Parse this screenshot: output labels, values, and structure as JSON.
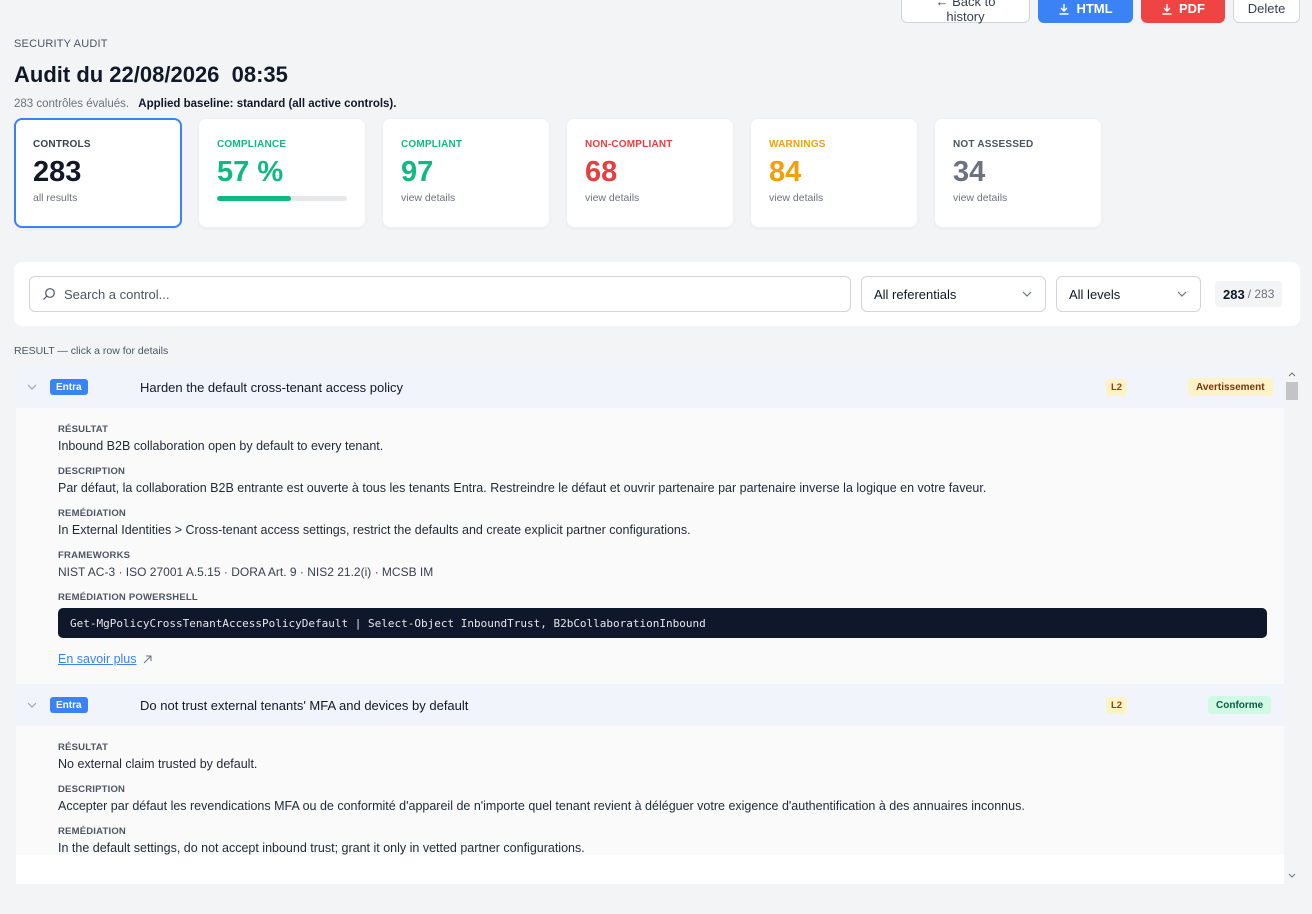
{
  "toolbar": {
    "back_label": "← Back to history",
    "html_label": "HTML",
    "pdf_label": "PDF",
    "delete_label": "Delete"
  },
  "header": {
    "eyebrow": "SECURITY AUDIT",
    "title": "Audit du 22/08/2026  08:35",
    "controls_evaluated": "283 contrôles évalués.",
    "baseline": "Applied baseline: standard (all active controls)."
  },
  "cards": {
    "controls": {
      "label": "CONTROLS",
      "value": "283",
      "sub": "all results"
    },
    "compliance": {
      "label": "COMPLIANCE",
      "value": "57 %",
      "progress": 0.57
    },
    "compliant": {
      "label": "COMPLIANT",
      "value": "97",
      "sub": "view details"
    },
    "non_compliant": {
      "label": "NON-COMPLIANT",
      "value": "68",
      "sub": "view details"
    },
    "warnings": {
      "label": "WARNINGS",
      "value": "84",
      "sub": "view details"
    },
    "not_assessed": {
      "label": "NOT ASSESSED",
      "value": "34",
      "sub": "view details"
    }
  },
  "colors": {
    "accent": "#3b82f6",
    "compliance": "#10b981",
    "compliant": "#10b981",
    "non_compliant": "#e53e3e",
    "warnings": "#f59e0b",
    "not_assessed": "#6b7280"
  },
  "filters": {
    "search_placeholder": "Search a control...",
    "referential": "All referentials",
    "level": "All levels",
    "count_shown": "283",
    "count_total": "/ 283"
  },
  "result_label": "RESULT — click a row for details",
  "rows": [
    {
      "tag": "Entra",
      "title": "Harden the default cross-tenant access policy",
      "level": "L2",
      "status": "Avertissement",
      "result_label": "RÉSULTAT",
      "result": "Inbound B2B collaboration open by default to every tenant.",
      "description_label": "DESCRIPTION",
      "description": "Par défaut, la collaboration B2B entrante est ouverte à tous les tenants Entra. Restreindre le défaut et ouvrir partenaire par partenaire inverse la logique en votre faveur.",
      "remediation_label": "REMÉDIATION",
      "remediation": "In External Identities > Cross-tenant access settings, restrict the defaults and create explicit partner configurations.",
      "frameworks_label": "FRAMEWORKS",
      "frameworks": "NIST AC-3 · ISO 27001 A.5.15 · DORA Art. 9 · NIS2 21.2(i) · MCSB IM",
      "powershell_label": "REMÉDIATION POWERSHELL",
      "powershell": "Get-MgPolicyCrossTenantAccessPolicyDefault | Select-Object InboundTrust, B2bCollaborationInbound",
      "learn_more": "En savoir plus"
    },
    {
      "tag": "Entra",
      "title": "Do not trust external tenants' MFA and devices by default",
      "level": "L2",
      "status": "Conforme",
      "result_label": "RÉSULTAT",
      "result": "No external claim trusted by default.",
      "description_label": "DESCRIPTION",
      "description": "Accepter par défaut les revendications MFA ou de conformité d'appareil de n'importe quel tenant revient à déléguer votre exigence d'authentification à des annuaires inconnus.",
      "remediation_label": "REMÉDIATION",
      "remediation": "In the default settings, do not accept inbound trust; grant it only in vetted partner configurations."
    }
  ]
}
